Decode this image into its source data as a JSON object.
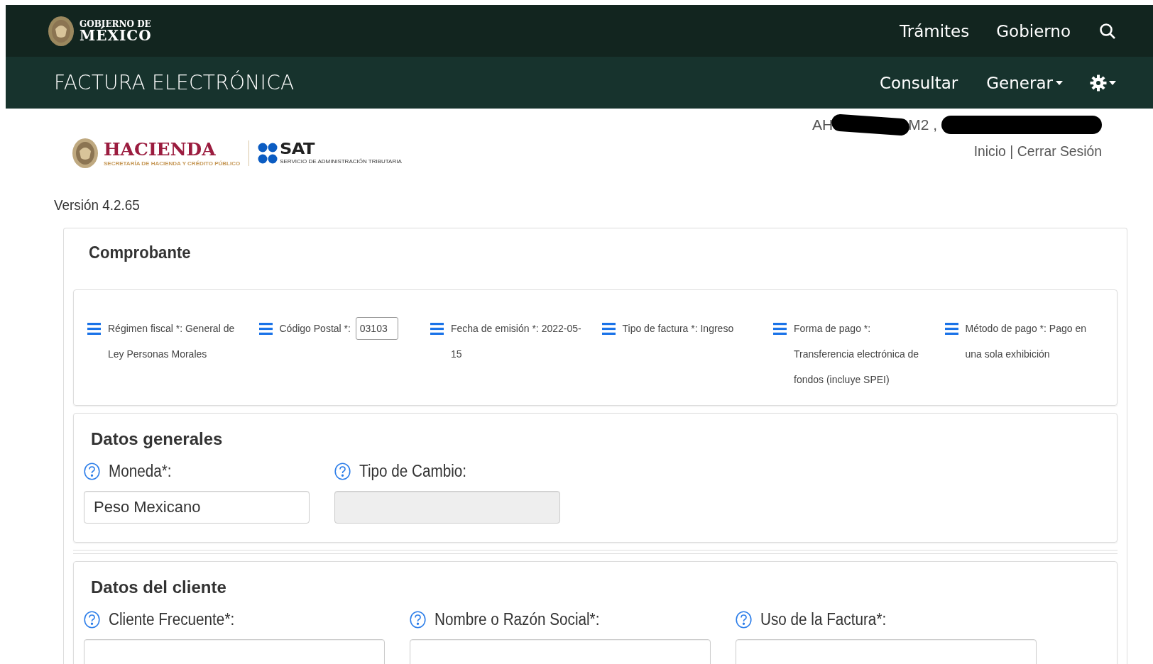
{
  "top_bar": {
    "brand_line_1": "GOBIERNO DE",
    "brand_line_2": "MÉXICO",
    "links": [
      "Trámites",
      "Gobierno"
    ]
  },
  "app_bar": {
    "title": "FACTURA ELECTRÓNICA",
    "menu": [
      {
        "label": "Consultar",
        "kind": "link"
      },
      {
        "label": "Generar",
        "kind": "dropdown"
      }
    ]
  },
  "logos": {
    "hacienda": "HACIENDA",
    "hacienda_sub": "SECRETARÍA DE HACIENDA Y CRÉDITO PÚBLICO",
    "sat": "SAT",
    "sat_sub": "SERVICIO DE ADMINISTRACIÓN TRIBUTARIA"
  },
  "user": {
    "visible_start": "AH",
    "visible_middle": "M2 ,",
    "links": [
      "Inicio",
      "Cerrar Sesión"
    ],
    "separator": "|"
  },
  "version": "Versión 4.2.65",
  "comprobante": {
    "title": "Comprobante",
    "items": [
      {
        "label": "Régimen fiscal *:",
        "value": "General de Ley Personas Morales",
        "kind": "text"
      },
      {
        "label": "Código Postal *:",
        "value": "03103",
        "kind": "input"
      },
      {
        "label": "Fecha de emisión *:",
        "value": "2022-05-15",
        "kind": "text"
      },
      {
        "label": "Tipo de factura *:",
        "value": "Ingreso",
        "kind": "text"
      },
      {
        "label": "Forma de pago *:",
        "value": "Transferencia electrónica de fondos (incluye SPEI)",
        "kind": "text"
      },
      {
        "label": "Método de pago *:",
        "value": "Pago en una sola exhibición",
        "kind": "text"
      }
    ]
  },
  "sections": [
    {
      "title": "Datos generales",
      "fields": [
        {
          "label": "Moneda*:",
          "value": "Peso Mexicano",
          "disabled": false
        },
        {
          "label": "Tipo de Cambio:",
          "disabled": true
        }
      ]
    },
    {
      "title": "Datos del cliente",
      "fields": [
        {
          "label": "Cliente Frecuente*:",
          "disabled": false
        },
        {
          "label": "Nombre o Razón Social*:",
          "disabled": false
        },
        {
          "label": "Uso de la Factura*:",
          "disabled": false
        }
      ]
    }
  ]
}
